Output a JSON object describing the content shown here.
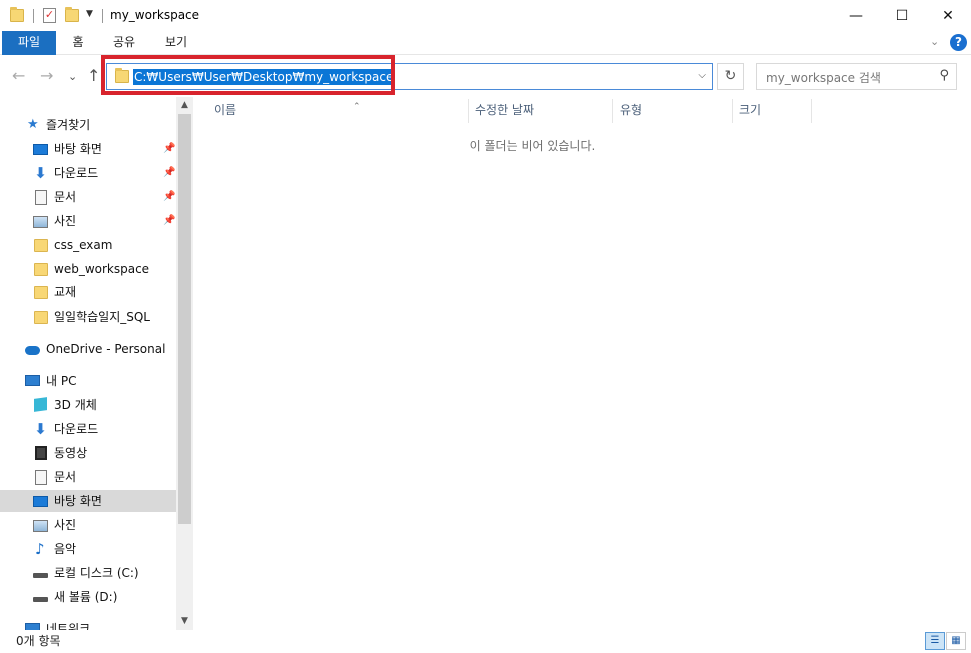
{
  "window": {
    "title": "my_workspace",
    "minimize": "—",
    "maximize": "☐",
    "close": "✕"
  },
  "ribbon": {
    "tabs": [
      "파일",
      "홈",
      "공유",
      "보기"
    ],
    "help": "?"
  },
  "address": {
    "path": "C:₩Users₩User₩Desktop₩my_workspace",
    "search_placeholder": "my_workspace 검색"
  },
  "nav_buttons": {
    "back": "←",
    "forward": "→",
    "recent": "⌄",
    "up": "↑",
    "refresh": "↻"
  },
  "navpane": {
    "items": [
      {
        "label": "즐겨찾기",
        "icon": "star-icon"
      },
      {
        "label": "바탕 화면",
        "icon": "desktop-icon",
        "pinned": true
      },
      {
        "label": "다운로드",
        "icon": "download-icon",
        "pinned": true
      },
      {
        "label": "문서",
        "icon": "document-icon",
        "pinned": true
      },
      {
        "label": "사진",
        "icon": "pictures-icon",
        "pinned": true
      },
      {
        "label": "css_exam",
        "icon": "folder-icon"
      },
      {
        "label": "web_workspace",
        "icon": "folder-icon"
      },
      {
        "label": "교재",
        "icon": "folder-icon"
      },
      {
        "label": "일일학습일지_SQL",
        "icon": "folder-icon"
      },
      {
        "label": "OneDrive - Personal",
        "icon": "onedrive-icon"
      },
      {
        "label": "내 PC",
        "icon": "pc-icon"
      },
      {
        "label": "3D 개체",
        "icon": "3d-objects-icon"
      },
      {
        "label": "다운로드",
        "icon": "download-icon"
      },
      {
        "label": "동영상",
        "icon": "video-icon"
      },
      {
        "label": "문서",
        "icon": "document-icon"
      },
      {
        "label": "바탕 화면",
        "icon": "desktop-icon",
        "selected": true
      },
      {
        "label": "사진",
        "icon": "pictures-icon"
      },
      {
        "label": "음악",
        "icon": "music-icon"
      },
      {
        "label": "로컬 디스크 (C:)",
        "icon": "local-disk-icon"
      },
      {
        "label": "새 볼륨 (D:)",
        "icon": "drive-icon"
      },
      {
        "label": "네트워크",
        "icon": "network-icon"
      }
    ]
  },
  "columns": {
    "name": "이름",
    "modified": "수정한 날짜",
    "type": "유형",
    "size": "크기"
  },
  "content": {
    "empty_message": "이 폴더는 비어 있습니다."
  },
  "status": {
    "item_count": "0개 항목"
  },
  "colors": {
    "accent": "#1b6fc1",
    "selection": "#0b76d6",
    "highlight_border": "#d8242d"
  }
}
